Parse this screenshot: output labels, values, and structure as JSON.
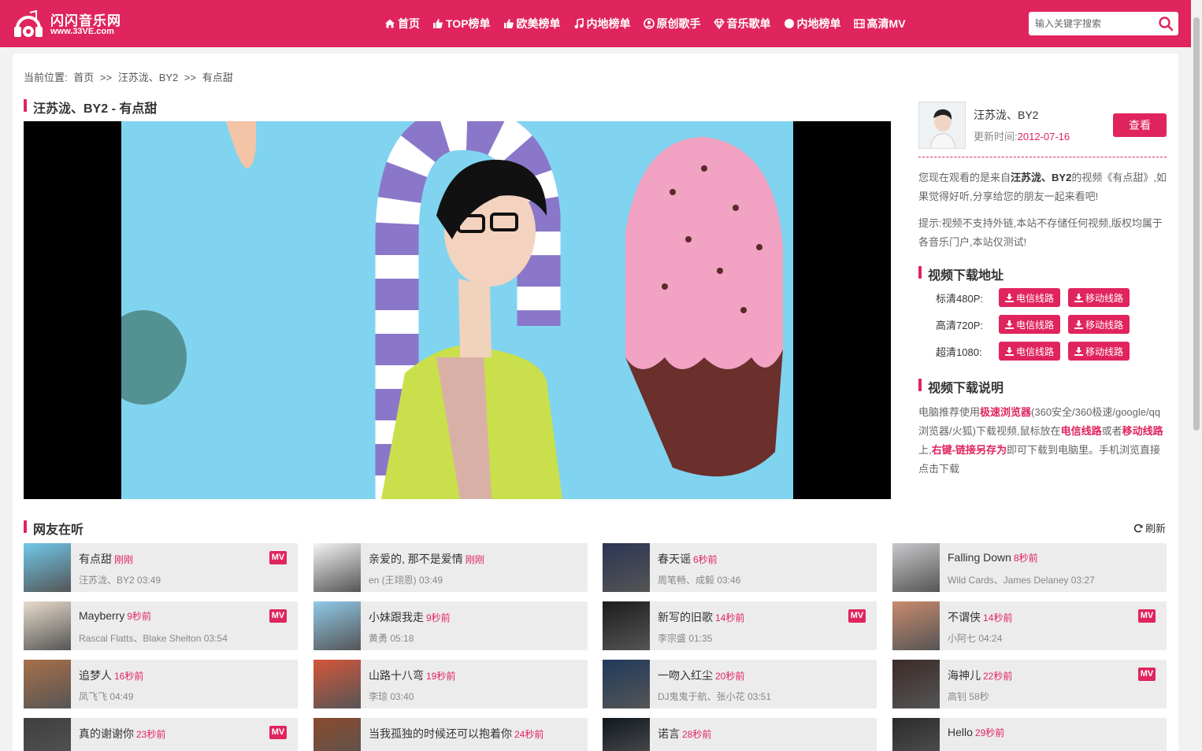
{
  "site": {
    "name": "闪闪音乐网",
    "url": "www.33VE.com",
    "brand_color": "#e0245e"
  },
  "nav": [
    {
      "label": "首页",
      "icon": "home-icon"
    },
    {
      "label": "TOP榜单",
      "icon": "thumbs-up-icon"
    },
    {
      "label": "欧美榜单",
      "icon": "thumbs-up-icon"
    },
    {
      "label": "内地榜单",
      "icon": "music-note-icon"
    },
    {
      "label": "原创歌手",
      "icon": "user-circle-icon"
    },
    {
      "label": "音乐歌单",
      "icon": "diamond-icon"
    },
    {
      "label": "内地榜单",
      "icon": "circle-icon"
    },
    {
      "label": "高清MV",
      "icon": "film-icon"
    }
  ],
  "search": {
    "placeholder": "输入关键字搜索"
  },
  "breadcrumb": {
    "prefix": "当前位置:",
    "home": "首页",
    "sep": ">>",
    "artist": "汪苏泷、BY2",
    "song": "有点甜"
  },
  "video": {
    "title": "汪苏泷、BY2 - 有点甜"
  },
  "artist": {
    "name": "汪苏泷、BY2",
    "updated_label": "更新时间:",
    "updated_date": "2012-07-16",
    "view_button": "查看"
  },
  "sidebar": {
    "intro_pre": "您现在观看的是来自",
    "intro_artist": "汪苏泷、BY2",
    "intro_mid": "的视频《有点甜》,如果觉得好听,分享给您的朋友一起来看吧!",
    "notice": "提示:视频不支持外链,本站不存储任何视频,版权均属于各音乐门户,本站仅测试!",
    "download_title": "视频下载地址",
    "downloads": [
      {
        "label": "标清480P:",
        "telecom": "电信线路",
        "mobile": "移动线路"
      },
      {
        "label": "高清720P:",
        "telecom": "电信线路",
        "mobile": "移动线路"
      },
      {
        "label": "超清1080:",
        "telecom": "电信线路",
        "mobile": "移动线路"
      }
    ],
    "help_title": "视频下载说明",
    "help_1": "电脑推荐使用",
    "help_browser": "极速浏览器",
    "help_2": "(360安全/360极速/google/qq浏览器/火狐)下载视频,鼠标放在",
    "help_telecom": "电信线路",
    "help_3": "或者",
    "help_mobile": "移动线路",
    "help_4": "上,",
    "help_saveas": "右键-链接另存为",
    "help_5": "即可下载到电脑里。手机浏览直接点击下载"
  },
  "listening": {
    "title": "网友在听",
    "refresh": "刷新",
    "items": [
      {
        "title": "有点甜",
        "time": "刚刚",
        "meta": "汪苏泷、BY2 03:49",
        "mv": "MV",
        "thumb": "#6fc8ea"
      },
      {
        "title": "亲爱的, 那不是爱情",
        "time": "刚刚",
        "meta": "en (王翊恩) 03:49",
        "mv": "",
        "thumb": "#f4f4f4"
      },
      {
        "title": "春天谣",
        "time": "6秒前",
        "meta": "周笔畅、成毅 03:46",
        "mv": "",
        "thumb": "#2c3554"
      },
      {
        "title": "Falling Down",
        "time": "8秒前",
        "meta": "Wild Cards、James Delaney 03:27",
        "mv": "",
        "thumb": "#c9c9cc"
      },
      {
        "title": "Mayberry",
        "time": "9秒前",
        "meta": "Rascal Flatts、Blake Shelton 03:54",
        "mv": "MV",
        "thumb": "#e8dccb"
      },
      {
        "title": "小妹跟我走",
        "time": "9秒前",
        "meta": "黄勇 05:18",
        "mv": "",
        "thumb": "#8fc9e8"
      },
      {
        "title": "新写的旧歌",
        "time": "14秒前",
        "meta": "李宗盛 01:35",
        "mv": "MV",
        "thumb": "#1c1c1c"
      },
      {
        "title": "不谓侠",
        "time": "14秒前",
        "meta": "小阿七 04:24",
        "mv": "MV",
        "thumb": "#c98a6d"
      },
      {
        "title": "追梦人",
        "time": "16秒前",
        "meta": "凤飞飞 04:49",
        "mv": "",
        "thumb": "#a87048"
      },
      {
        "title": "山路十八弯",
        "time": "19秒前",
        "meta": "李琼 03:40",
        "mv": "",
        "thumb": "#d4563b"
      },
      {
        "title": "一吻入红尘",
        "time": "20秒前",
        "meta": "DJ鬼鬼于航、张小花 03:51",
        "mv": "",
        "thumb": "#203a5c"
      },
      {
        "title": "海神儿",
        "time": "22秒前",
        "meta": "高钊 58秒",
        "mv": "MV",
        "thumb": "#3b2b28"
      },
      {
        "title": "真的谢谢你",
        "time": "23秒前",
        "meta": "",
        "mv": "MV",
        "thumb": "#3f3f3f"
      },
      {
        "title": "当我孤独的时候还可以抱着你",
        "time": "24秒前",
        "meta": "",
        "mv": "",
        "thumb": "#8a4a2c"
      },
      {
        "title": "诺言",
        "time": "28秒前",
        "meta": "",
        "mv": "",
        "thumb": "#101820"
      },
      {
        "title": "Hello",
        "time": "29秒前",
        "meta": "",
        "mv": "",
        "thumb": "#2b2b2b"
      }
    ]
  }
}
